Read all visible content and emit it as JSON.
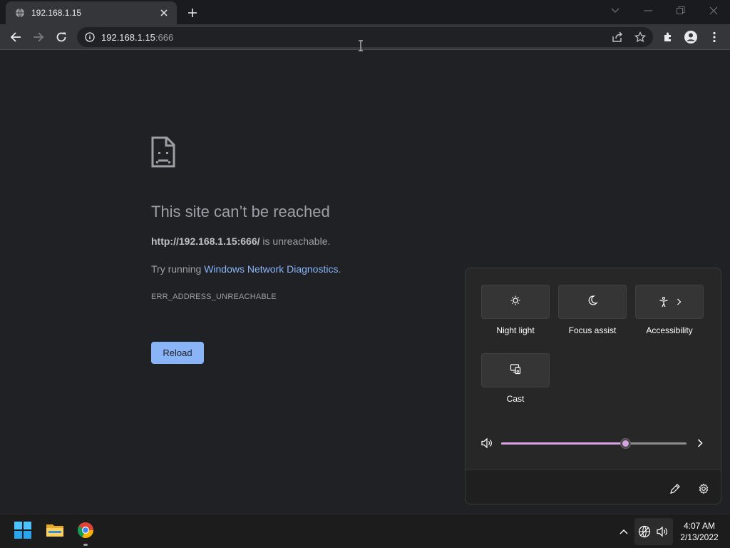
{
  "browser": {
    "tab_title": "192.168.1.15",
    "url_host": "192.168.1.15",
    "url_rest": ":666"
  },
  "error_page": {
    "title": "This site can’t be reached",
    "url_bold": "http://192.168.1.15:666/",
    "desc_suffix": " is unreachable.",
    "diag_prefix": "Try running ",
    "diag_link": "Windows Network Diagnostics",
    "diag_suffix": ".",
    "error_code": "ERR_ADDRESS_UNREACHABLE",
    "reload_label": "Reload"
  },
  "quick_settings": {
    "tiles": [
      {
        "label": "Night light",
        "icon": "night-light-icon"
      },
      {
        "label": "Focus assist",
        "icon": "moon-icon"
      },
      {
        "label": "Accessibility",
        "icon": "accessibility-icon"
      },
      {
        "label": "Cast",
        "icon": "cast-icon"
      }
    ],
    "volume_percent": 67,
    "accent_color": "#d8a3e6"
  },
  "taskbar": {
    "time": "4:07 AM",
    "date": "2/13/2022"
  },
  "colors": {
    "link": "#8ab4f8",
    "page_bg": "#202124"
  }
}
